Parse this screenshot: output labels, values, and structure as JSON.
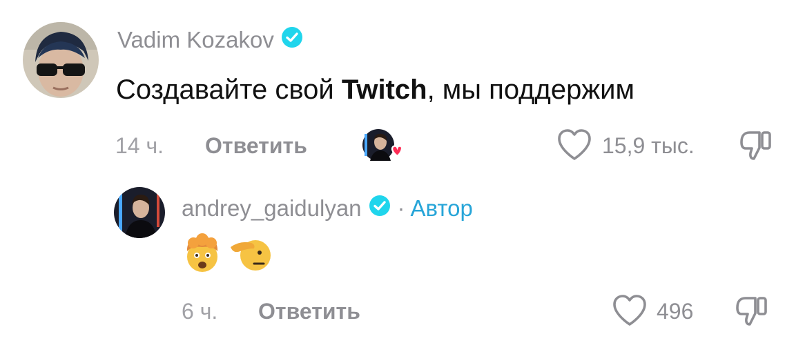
{
  "comment": {
    "username": "Vadim Kozakov",
    "text_prefix": "Создавайте свой ",
    "text_bold": "Twitch",
    "text_suffix": ", мы поддержим",
    "time": "14 ч.",
    "reply_label": "Ответить",
    "like_count": "15,9 тыс.",
    "icons": {
      "verified": "verified-badge-icon",
      "creator_liked": "creator-liked-heart-icon",
      "like": "heart-outline-icon",
      "dislike": "thumbs-down-outline-icon"
    }
  },
  "reply": {
    "username": "andrey_gaidulyan",
    "separator": "·",
    "author_tag": "Автор",
    "emojis": [
      "exploding-head-emoji",
      "saluting-face-emoji"
    ],
    "time": "6 ч.",
    "reply_label": "Ответить",
    "like_count": "496"
  },
  "colors": {
    "verified_badge": "#20d5ec",
    "author_tag": "#27a5d8",
    "creator_heart": "#fe2c55",
    "secondary_text": "#8e8e93"
  }
}
